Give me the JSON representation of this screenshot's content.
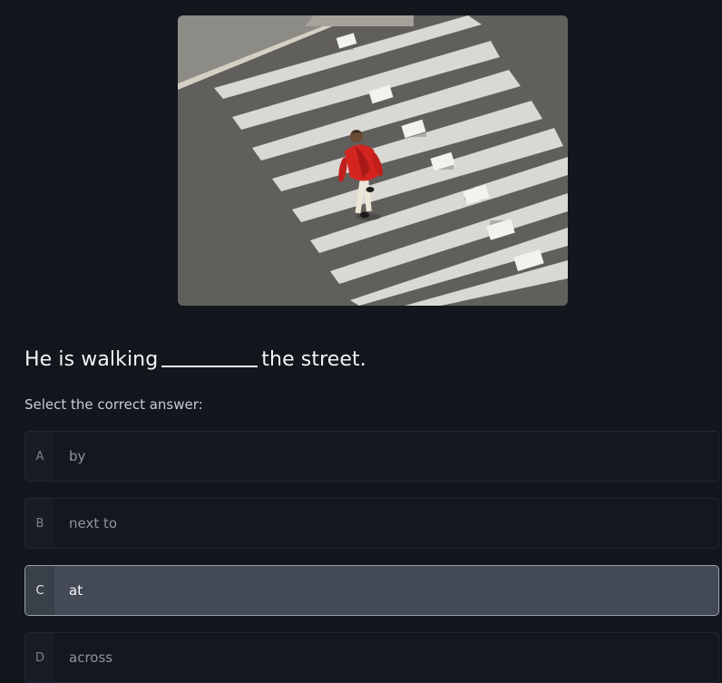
{
  "question": {
    "before_blank": "He is walking",
    "after_blank": "the street."
  },
  "prompt": "Select the correct answer:",
  "options": [
    {
      "letter": "A",
      "text": "by",
      "selected": false
    },
    {
      "letter": "B",
      "text": "next to",
      "selected": false
    },
    {
      "letter": "C",
      "text": "at",
      "selected": true
    },
    {
      "letter": "D",
      "text": "across",
      "selected": false
    }
  ],
  "colors": {
    "background": "#13161d",
    "selected_option": "#444a55",
    "jacket": "#d42420"
  }
}
